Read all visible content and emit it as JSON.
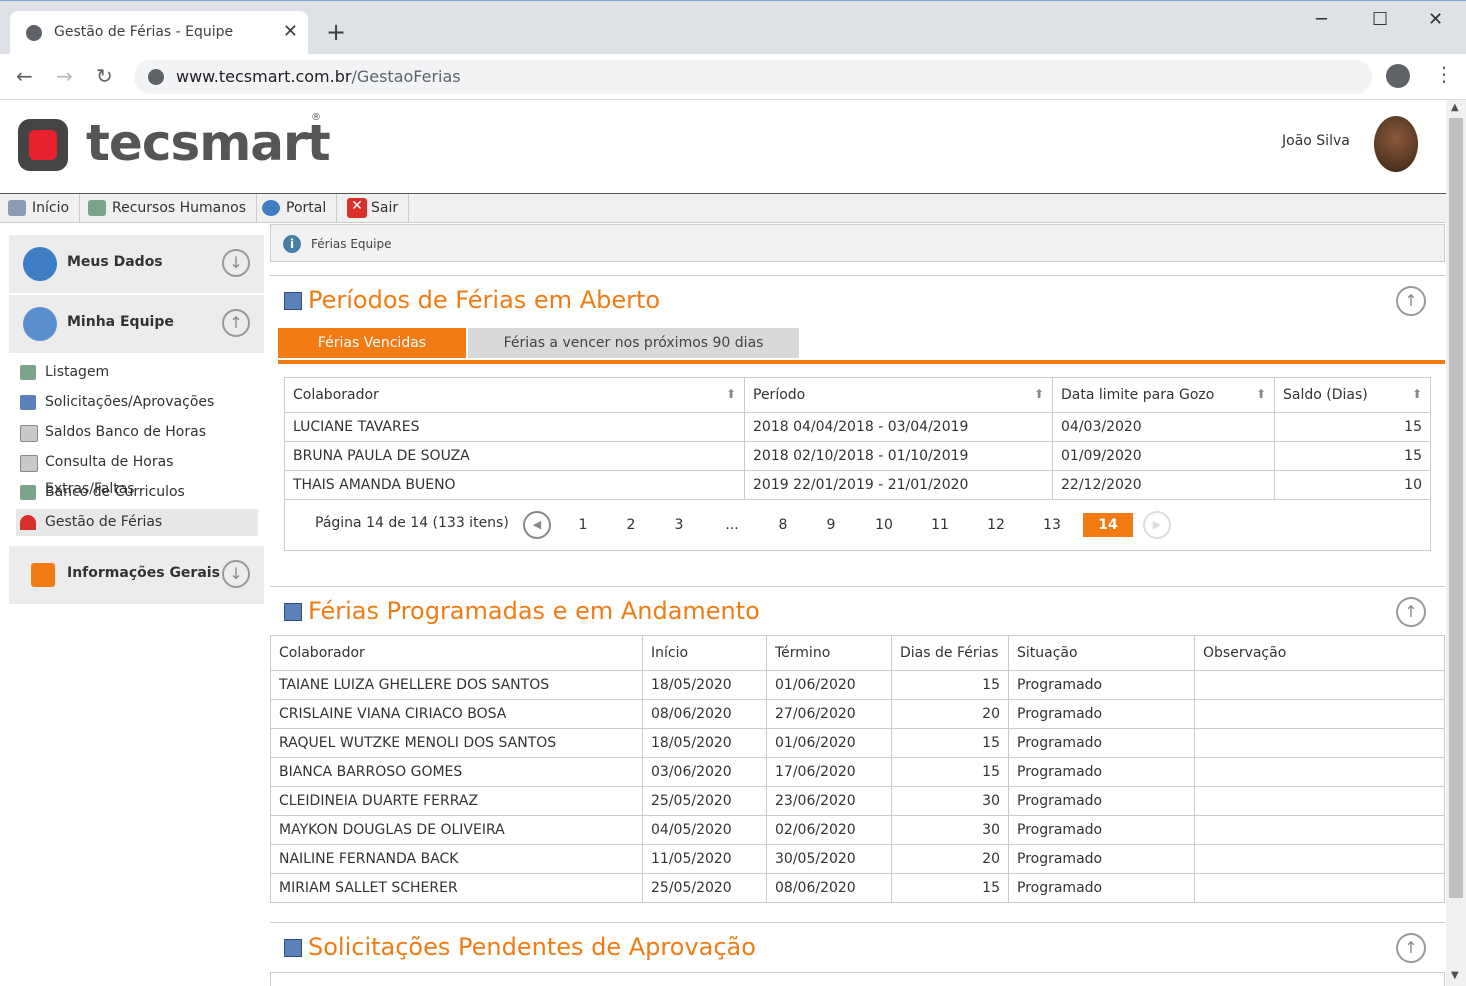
{
  "browser": {
    "tab_title": "Gestão de Férias - Equipe",
    "url_host": "www.tecsmart.com.br",
    "url_path": "/GestaoFerias"
  },
  "header": {
    "logo_text": "tecsmart",
    "logo_mark": "®",
    "user_name": "João Silva"
  },
  "menubar": [
    {
      "label": "Início",
      "icon": "home-icon"
    },
    {
      "label": "Recursos Humanos",
      "icon": "people-icon"
    },
    {
      "label": "Portal",
      "icon": "gear-icon"
    },
    {
      "label": "Sair",
      "icon": "close-icon"
    }
  ],
  "sidebar": {
    "meus_dados": "Meus Dados",
    "minha_equipe": "Minha Equipe",
    "informacoes_gerais": "Informações Gerais",
    "links": [
      "Listagem",
      "Solicitações/Aprovações",
      "Saldos Banco de Horas",
      "Consulta de Horas Extras/Faltas",
      "Banco de Curriculos",
      "Gestão de Férias"
    ]
  },
  "breadcrumb": "Férias Equipe",
  "section1": {
    "title": "Períodos de Férias em Aberto",
    "tabs": [
      "Férias Vencidas",
      "Férias a vencer nos próximos 90 dias"
    ],
    "columns": [
      "Colaborador",
      "Período",
      "Data limite para Gozo",
      "Saldo (Dias)"
    ],
    "rows": [
      [
        "LUCIANE TAVARES",
        "2018 04/04/2018 - 03/04/2019",
        "04/03/2020",
        "15"
      ],
      [
        "BRUNA PAULA DE SOUZA",
        "2018 02/10/2018 - 01/10/2019",
        "01/09/2020",
        "15"
      ],
      [
        "THAIS AMANDA BUENO",
        "2019 22/01/2019 - 21/01/2020",
        "22/12/2020",
        "10"
      ]
    ],
    "pager_info": "Página 14 de 14 (133 itens)",
    "pages": [
      "1",
      "2",
      "3",
      "...",
      "8",
      "9",
      "10",
      "11",
      "12",
      "13",
      "14"
    ]
  },
  "section2": {
    "title": "Férias Programadas e em Andamento",
    "columns": [
      "Colaborador",
      "Início",
      "Término",
      "Dias de Férias",
      "Situação",
      "Observação"
    ],
    "rows": [
      [
        "TAIANE LUIZA GHELLERE DOS SANTOS",
        "18/05/2020",
        "01/06/2020",
        "15",
        "Programado",
        ""
      ],
      [
        "CRISLAINE VIANA CIRIACO BOSA",
        "08/06/2020",
        "27/06/2020",
        "20",
        "Programado",
        ""
      ],
      [
        "RAQUEL WUTZKE MENOLI DOS SANTOS",
        "18/05/2020",
        "01/06/2020",
        "15",
        "Programado",
        ""
      ],
      [
        "BIANCA BARROSO GOMES",
        "03/06/2020",
        "17/06/2020",
        "15",
        "Programado",
        ""
      ],
      [
        "CLEIDINEIA DUARTE FERRAZ",
        "25/05/2020",
        "23/06/2020",
        "30",
        "Programado",
        ""
      ],
      [
        "MAYKON DOUGLAS DE OLIVEIRA",
        "04/05/2020",
        "02/06/2020",
        "30",
        "Programado",
        ""
      ],
      [
        "NAILINE FERNANDA BACK",
        "11/05/2020",
        "30/05/2020",
        "20",
        "Programado",
        ""
      ],
      [
        "MIRIAM SALLET SCHERER",
        "25/05/2020",
        "08/06/2020",
        "15",
        "Programado",
        ""
      ]
    ]
  },
  "section3": {
    "title": "Solicitações Pendentes de Aprovação"
  },
  "colors": {
    "accent": "#f27b13",
    "tab_inactive": "#d9d9d9"
  }
}
